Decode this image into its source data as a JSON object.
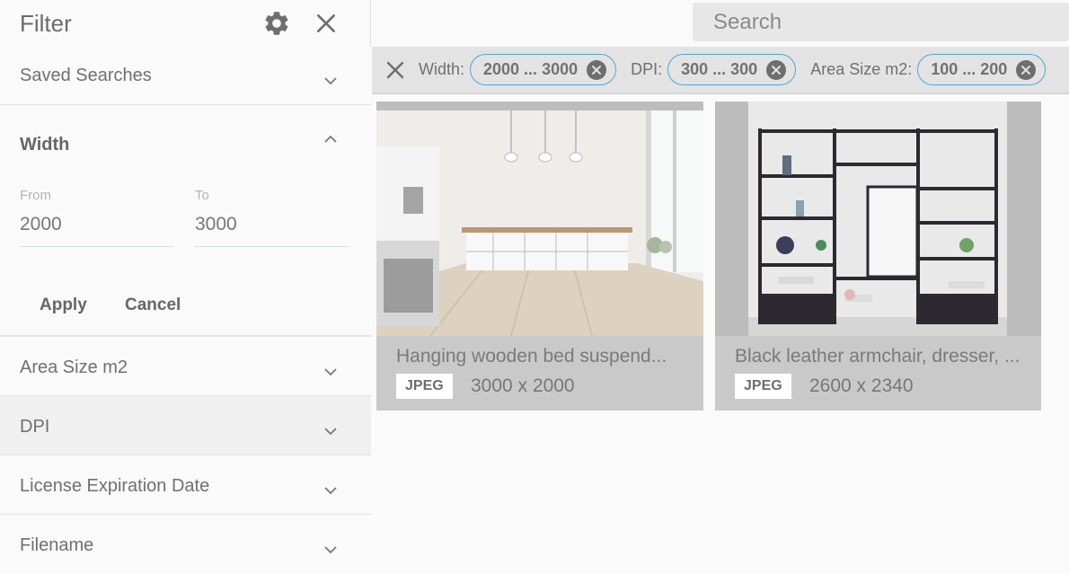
{
  "sidebar": {
    "title": "Filter",
    "sections": {
      "saved_searches": "Saved Searches",
      "area_size": "Area Size m2",
      "dpi": "DPI",
      "license": "License Expiration Date",
      "filename": "Filename"
    },
    "width": {
      "title": "Width",
      "from_label": "From",
      "from_value": "2000",
      "to_label": "To",
      "to_value": "3000",
      "apply_label": "Apply",
      "cancel_label": "Cancel"
    }
  },
  "search": {
    "placeholder": "Search"
  },
  "active_filters": [
    {
      "key": "Width:",
      "value": "2000 ... 3000"
    },
    {
      "key": "DPI:",
      "value": "300 ... 300"
    },
    {
      "key": "Area Size m2:",
      "value": "100 ... 200"
    }
  ],
  "results": [
    {
      "title": "Hanging wooden bed suspend...",
      "format": "JPEG",
      "dimensions": "3000 x 2000"
    },
    {
      "title": "Black leather armchair, dresser, ...",
      "format": "JPEG",
      "dimensions": "2600 x 2340"
    }
  ],
  "icons": {
    "settings": "gear-icon",
    "close": "close-icon",
    "expand": "chevron-down-icon",
    "collapse": "chevron-up-icon",
    "clear_chip": "circle-x-icon"
  },
  "colors": {
    "chip_border": "#4fa8d4",
    "accent_line": "#cfe3ea"
  }
}
